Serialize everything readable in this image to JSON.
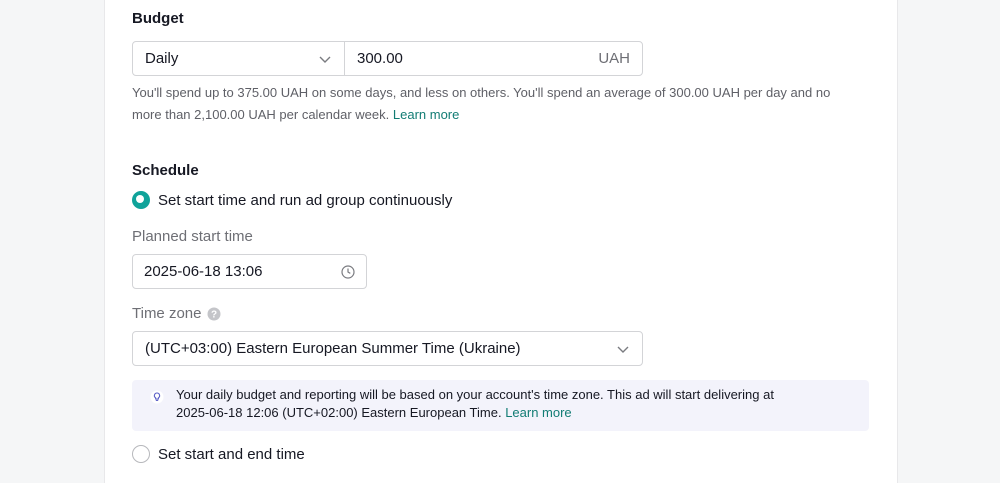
{
  "budget": {
    "title": "Budget",
    "type_selected": "Daily",
    "amount": "300.00",
    "currency": "UAH",
    "help_text_line1": "You'll spend up to 375.00 UAH on some days, and less on others. You'll spend an average of 300.00 UAH per day and no",
    "help_text_line2": "more than 2,100.00 UAH per calendar week.",
    "learn_more": "Learn more"
  },
  "schedule": {
    "title": "Schedule",
    "option_continuous": "Set start time and run ad group continuously",
    "option_continuous_selected": true,
    "planned_start_label": "Planned start time",
    "planned_start_value": "2025-06-18 13:06",
    "timezone_label": "Time zone",
    "timezone_value": "(UTC+03:00) Eastern European Summer Time (Ukraine)",
    "info_line1": "Your daily budget and reporting will be based on your account's time zone. This ad will start delivering at",
    "info_line2": "2025-06-18 12:06 (UTC+02:00) Eastern European Time.",
    "info_learn_more": "Learn more",
    "option_start_end": "Set start and end time",
    "option_start_end_selected": false
  },
  "icons": {
    "chevron": "chevron-down-icon",
    "clock": "clock-icon",
    "help": "question-icon",
    "bulb": "lightbulb-icon"
  },
  "colors": {
    "accent": "#10a39a",
    "link": "#127c74",
    "info_bg": "#f3f3fb"
  }
}
